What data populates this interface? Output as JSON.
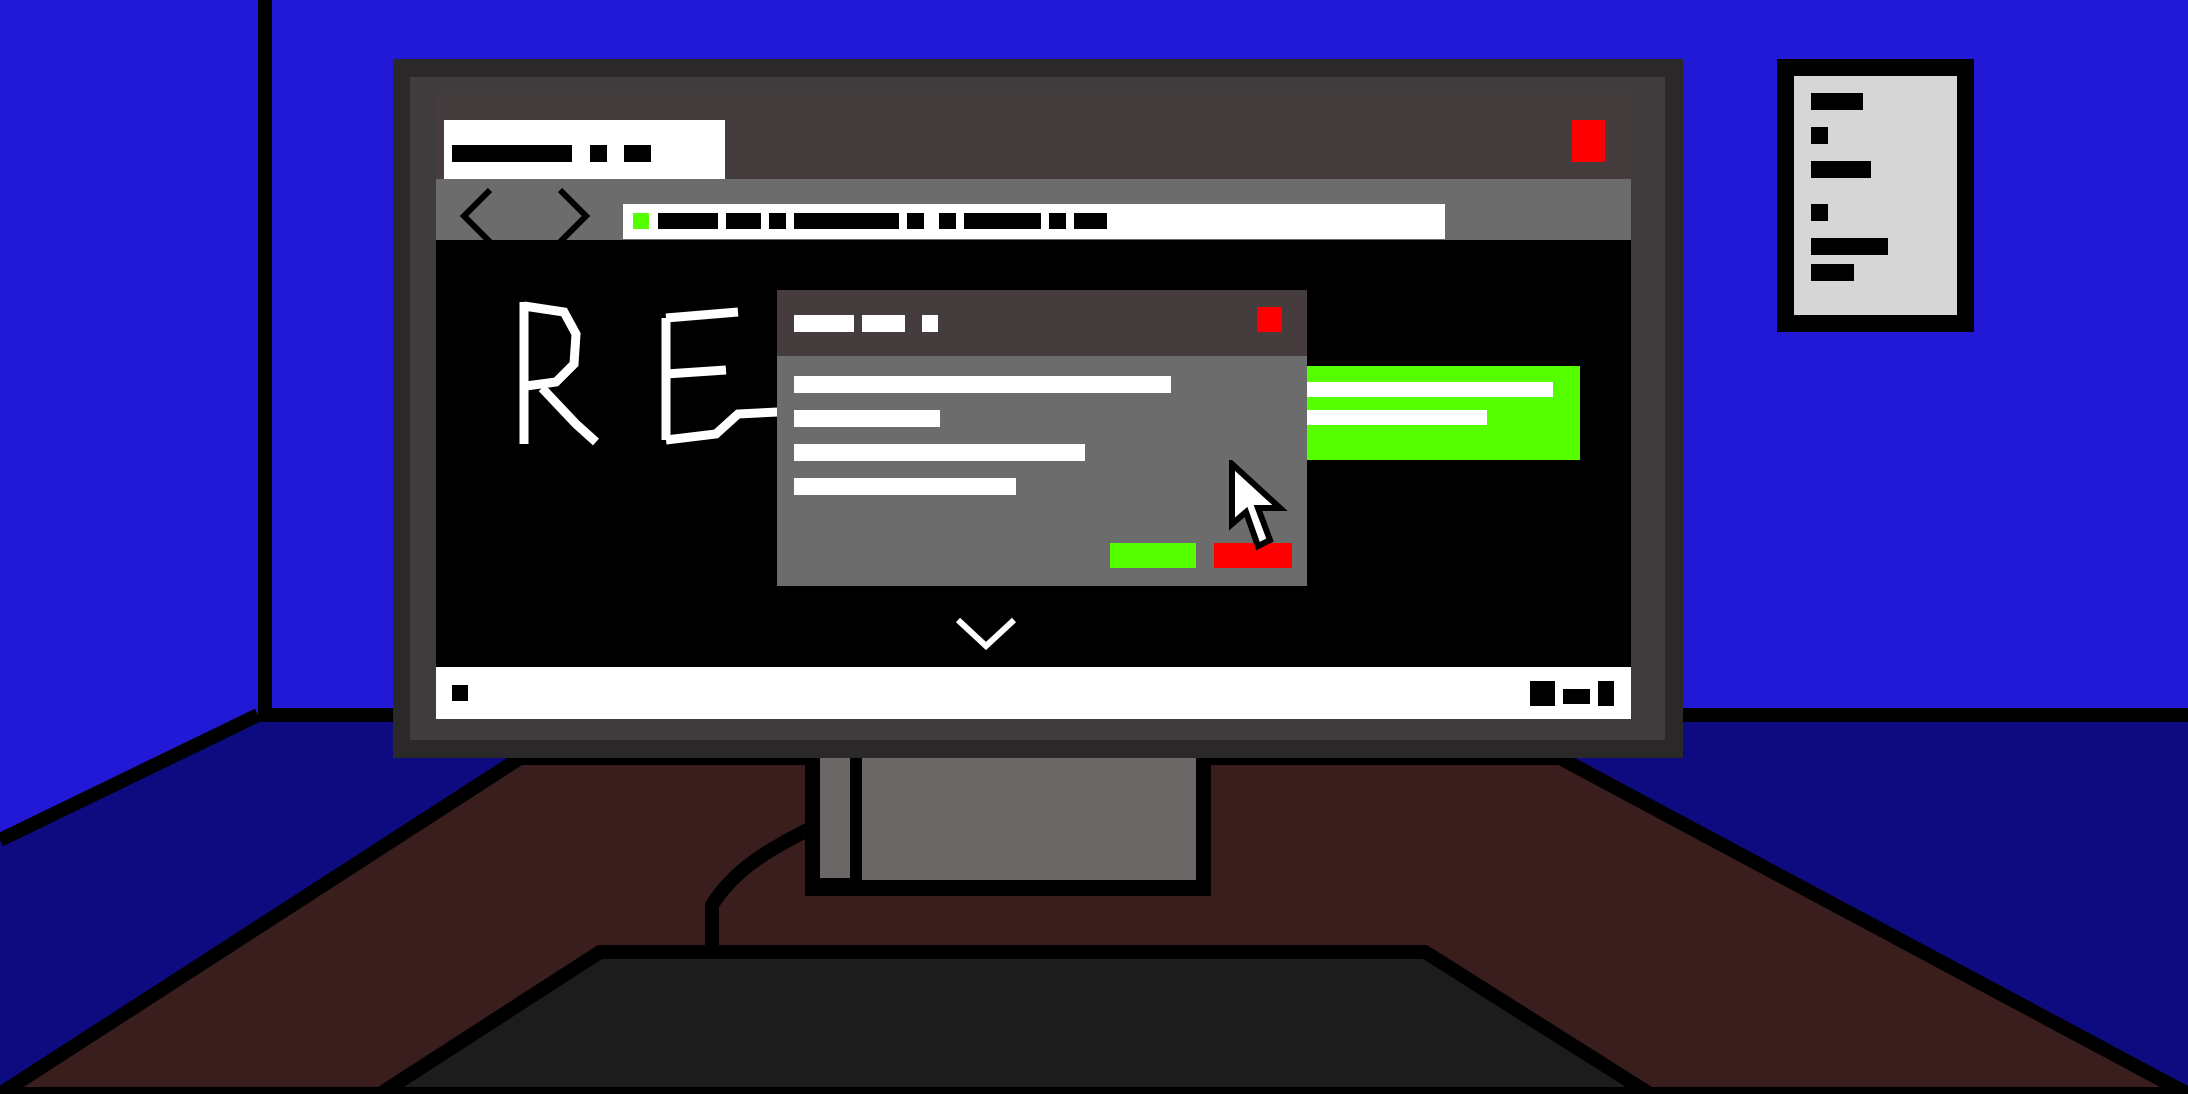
{
  "scene": {
    "wall_color": "#2219d6",
    "floor_color": "#0e0a80",
    "desk_color": "#3a1e1e",
    "monitor_color": "#2a2828"
  },
  "browser": {
    "tab_title": "",
    "url": "",
    "secure_indicator_color": "#55ff00",
    "close_color": "#ff0000",
    "page_heading": "RE",
    "green_panel_color": "#55ff00"
  },
  "dialog": {
    "title": "",
    "lines": [
      "",
      "",
      "",
      ""
    ],
    "ok_label": "",
    "cancel_label": "",
    "ok_color": "#55ff00",
    "cancel_color": "#ff0000"
  },
  "icons": {
    "back": "chevron-left-icon",
    "forward": "chevron-right-icon",
    "scroll_down": "chevron-down-icon",
    "cursor": "mouse-cursor-icon"
  }
}
